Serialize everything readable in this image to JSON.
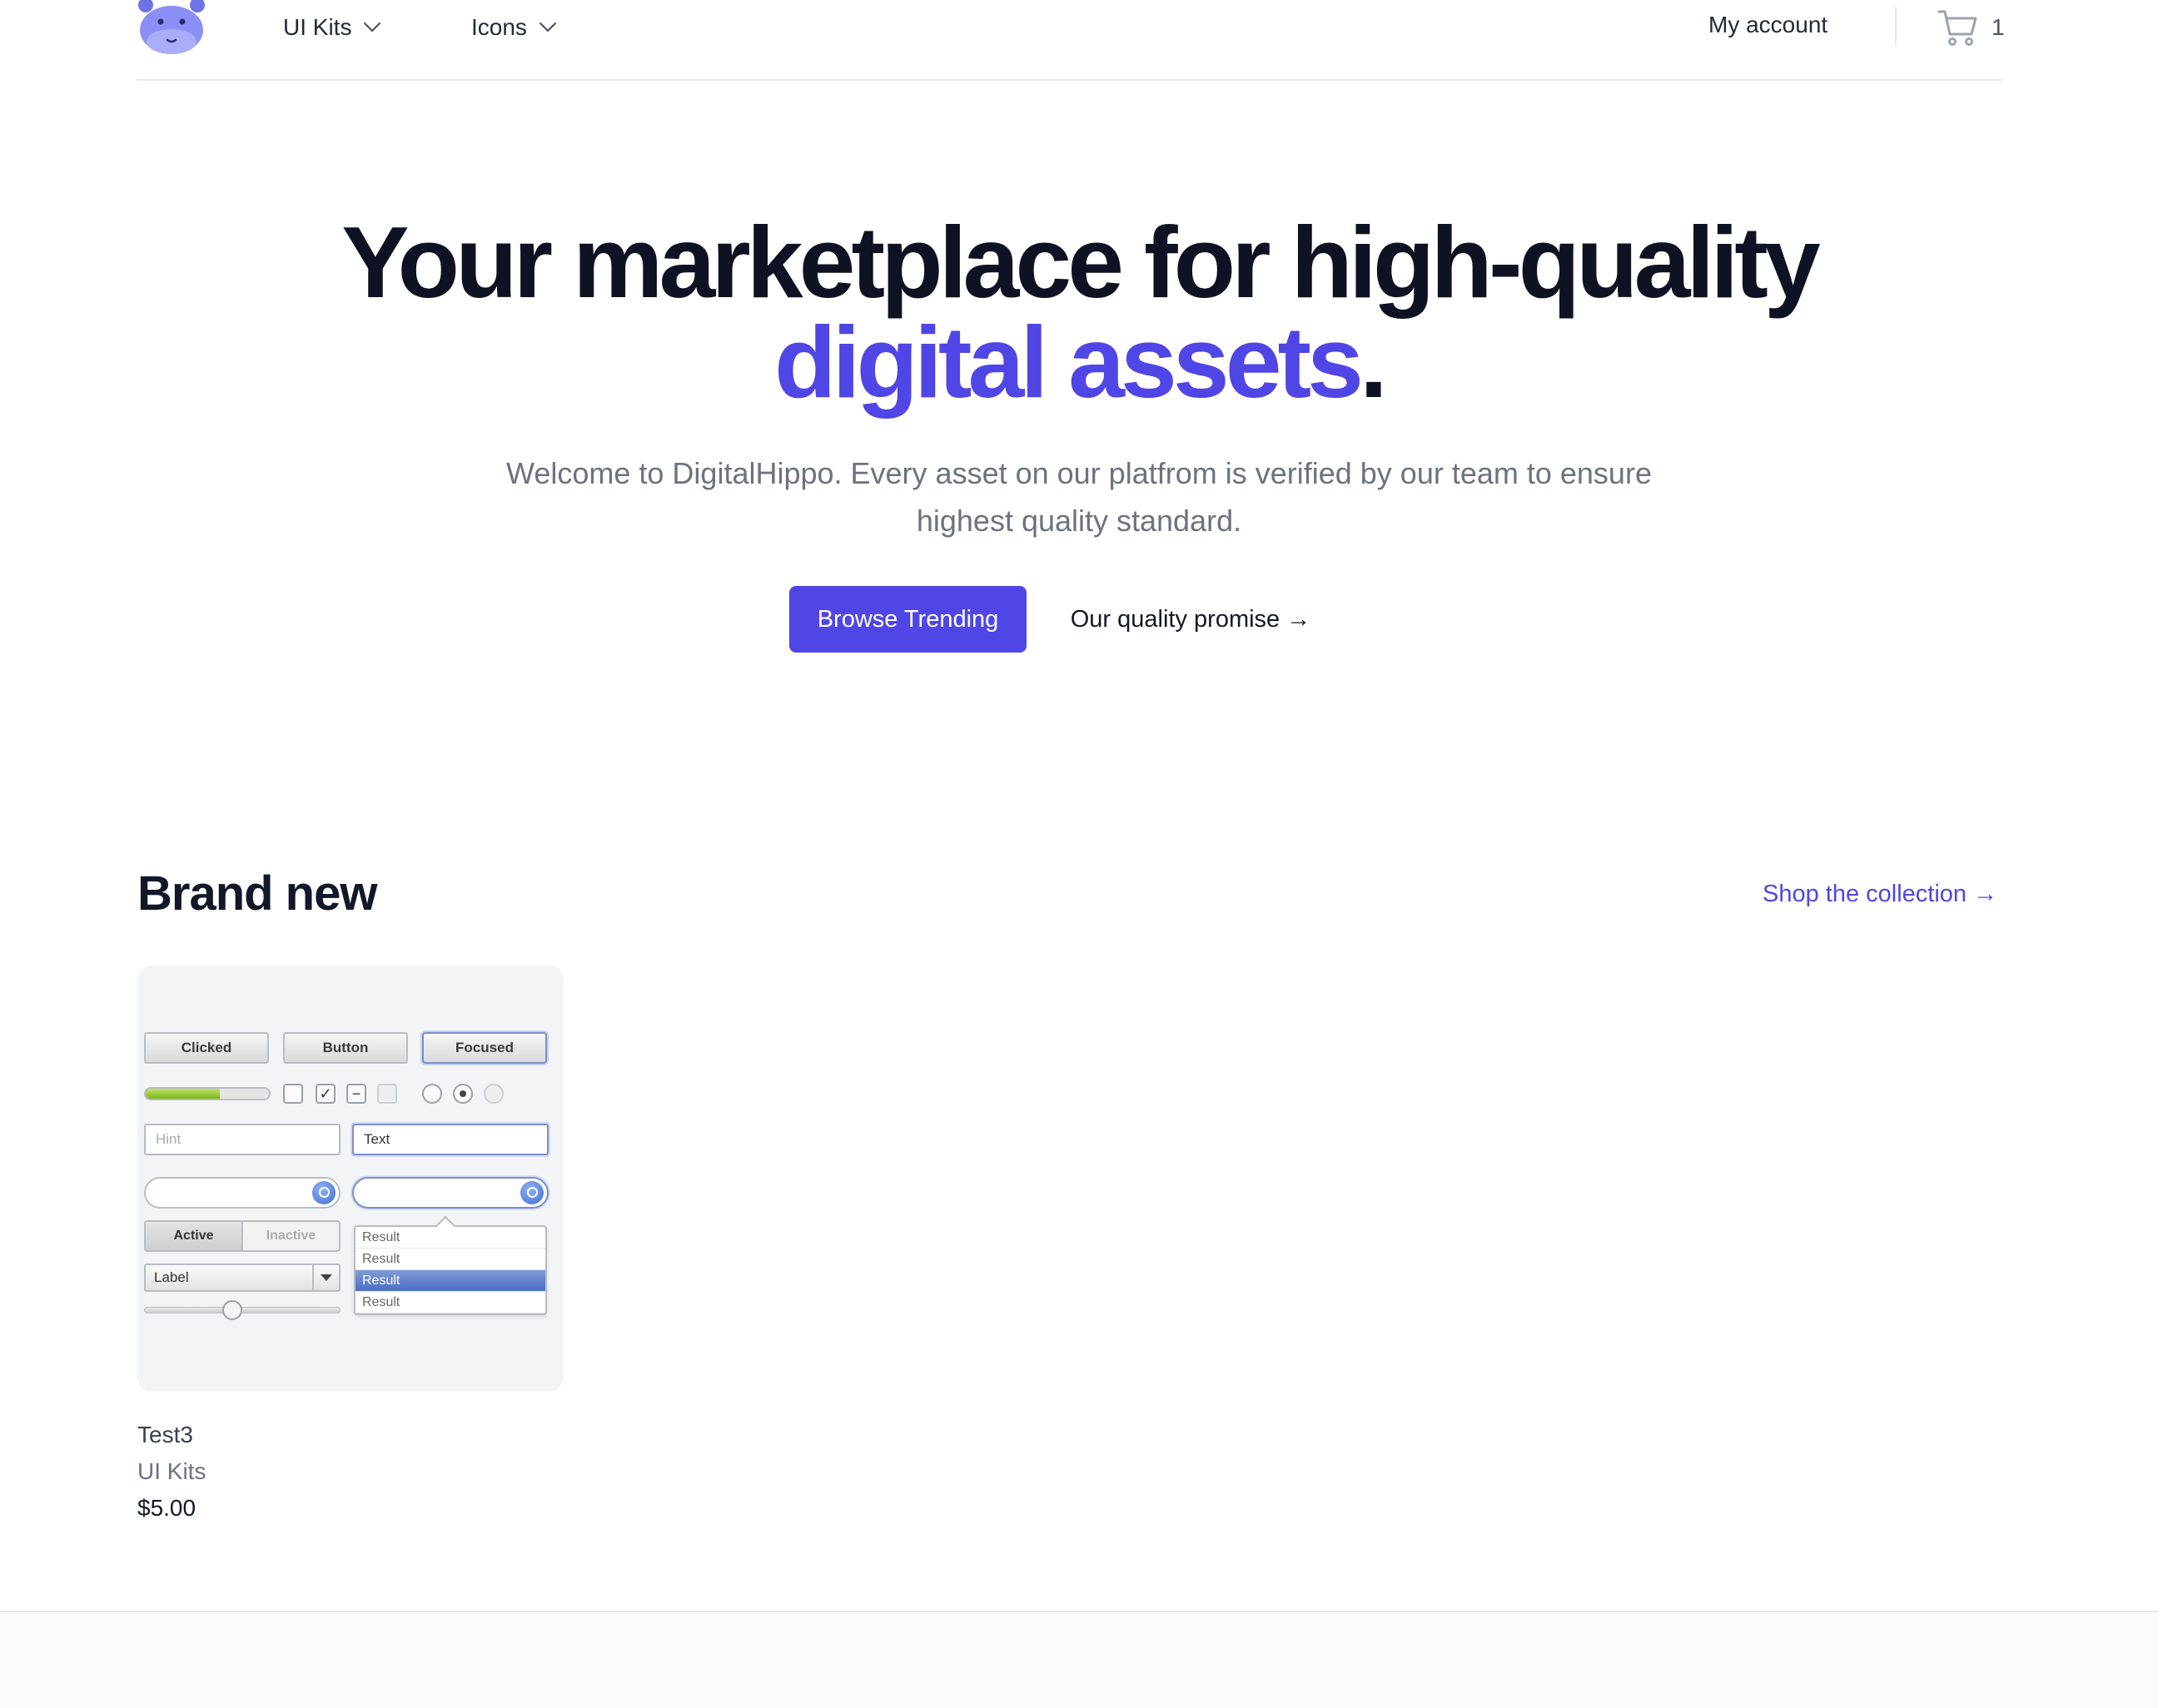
{
  "header": {
    "nav": [
      {
        "label": "UI Kits"
      },
      {
        "label": "Icons"
      }
    ],
    "account_label": "My account",
    "cart_count": "1"
  },
  "hero": {
    "title_part1": "Your marketplace for high-quality ",
    "title_accent": "digital assets",
    "title_end": ".",
    "subtitle": "Welcome to DigitalHippo. Every asset on our platfrom is verified by our team to ensure highest quality standard.",
    "primary_button": "Browse Trending",
    "secondary_button": "Our quality promise →"
  },
  "section": {
    "title": "Brand new",
    "link": "Shop the collection →"
  },
  "products": [
    {
      "name": "Test3",
      "category": "UI Kits",
      "price": "$5.00",
      "preview": {
        "buttons": [
          "Clicked",
          "Button",
          "Focused"
        ],
        "progress": 0.6,
        "input_hint": "Hint",
        "input_text": "Text",
        "segments": [
          "Active",
          "Inactive"
        ],
        "select_label": "Label",
        "slider": 0.45,
        "results": [
          "Result",
          "Result",
          "Result",
          "Result"
        ]
      }
    }
  ],
  "colors": {
    "accent": "#4f46e5",
    "heading": "#0f1222",
    "muted": "#6b7280",
    "logo": "#8b8ff5"
  },
  "icons": [
    "hippo-logo-icon",
    "chevron-down-icon",
    "cart-icon"
  ]
}
